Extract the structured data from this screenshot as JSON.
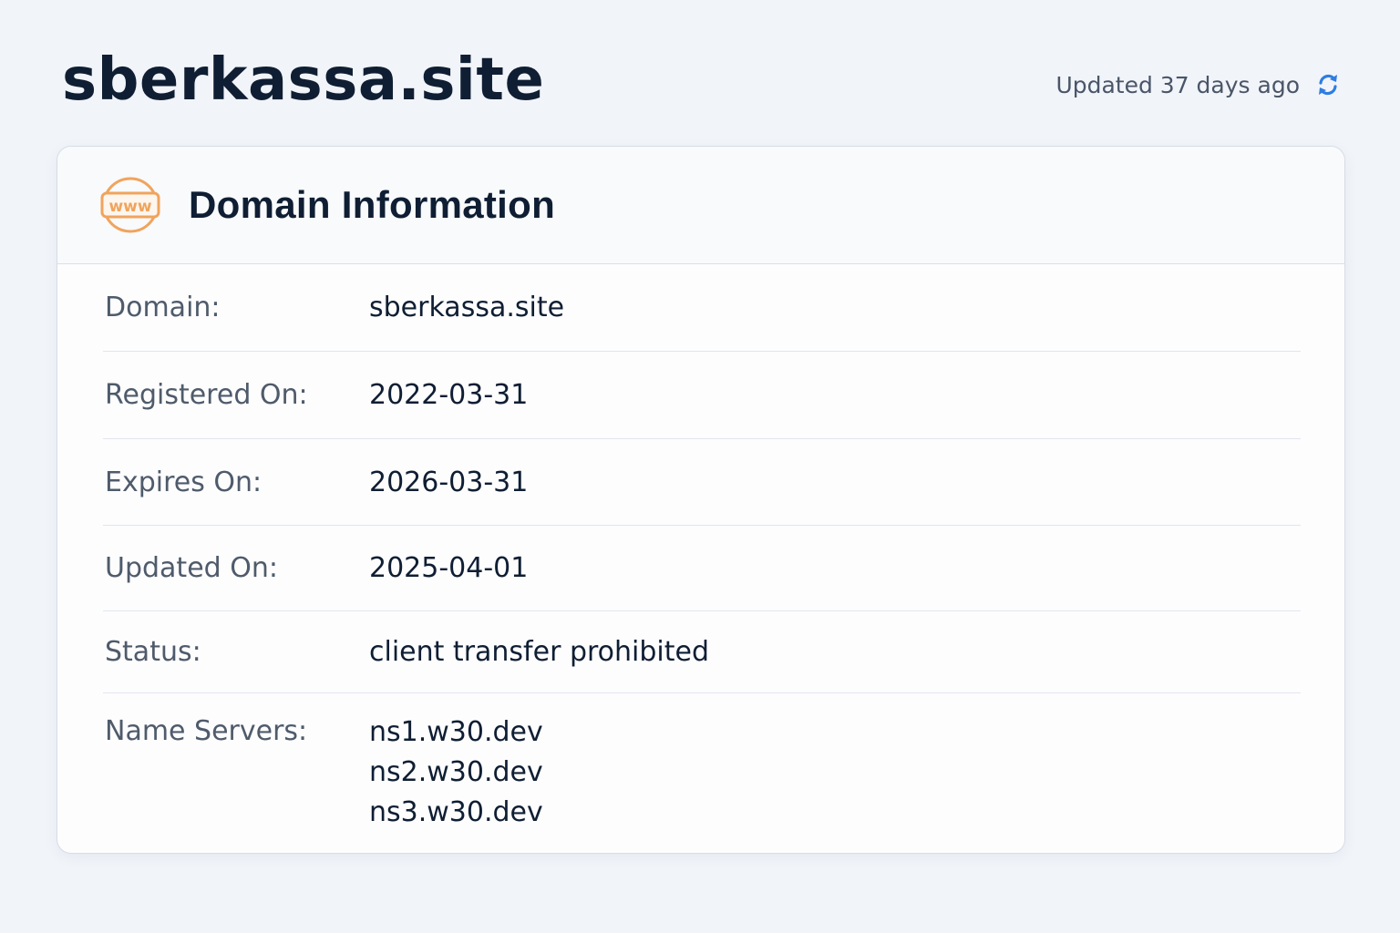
{
  "header": {
    "title": "sberkassa.site",
    "updated_text": "Updated 37 days ago",
    "refresh_icon": "refresh-icon"
  },
  "card": {
    "icon": "www-icon",
    "icon_text": "www",
    "title": "Domain Information",
    "rows": [
      {
        "label": "Domain:",
        "value": "sberkassa.site"
      },
      {
        "label": "Registered On:",
        "value": "2022-03-31"
      },
      {
        "label": "Expires On:",
        "value": "2026-03-31"
      },
      {
        "label": "Updated On:",
        "value": "2025-04-01"
      },
      {
        "label": "Status:",
        "value": "client transfer prohibited"
      }
    ],
    "name_servers": {
      "label": "Name Servers:",
      "values": [
        "ns1.w30.dev",
        "ns2.w30.dev",
        "ns3.w30.dev"
      ]
    }
  },
  "colors": {
    "accent": "#2f7de1",
    "icon_orange": "#f0a45c",
    "text_primary": "#0f1e33",
    "text_secondary": "#4f5b6b"
  }
}
